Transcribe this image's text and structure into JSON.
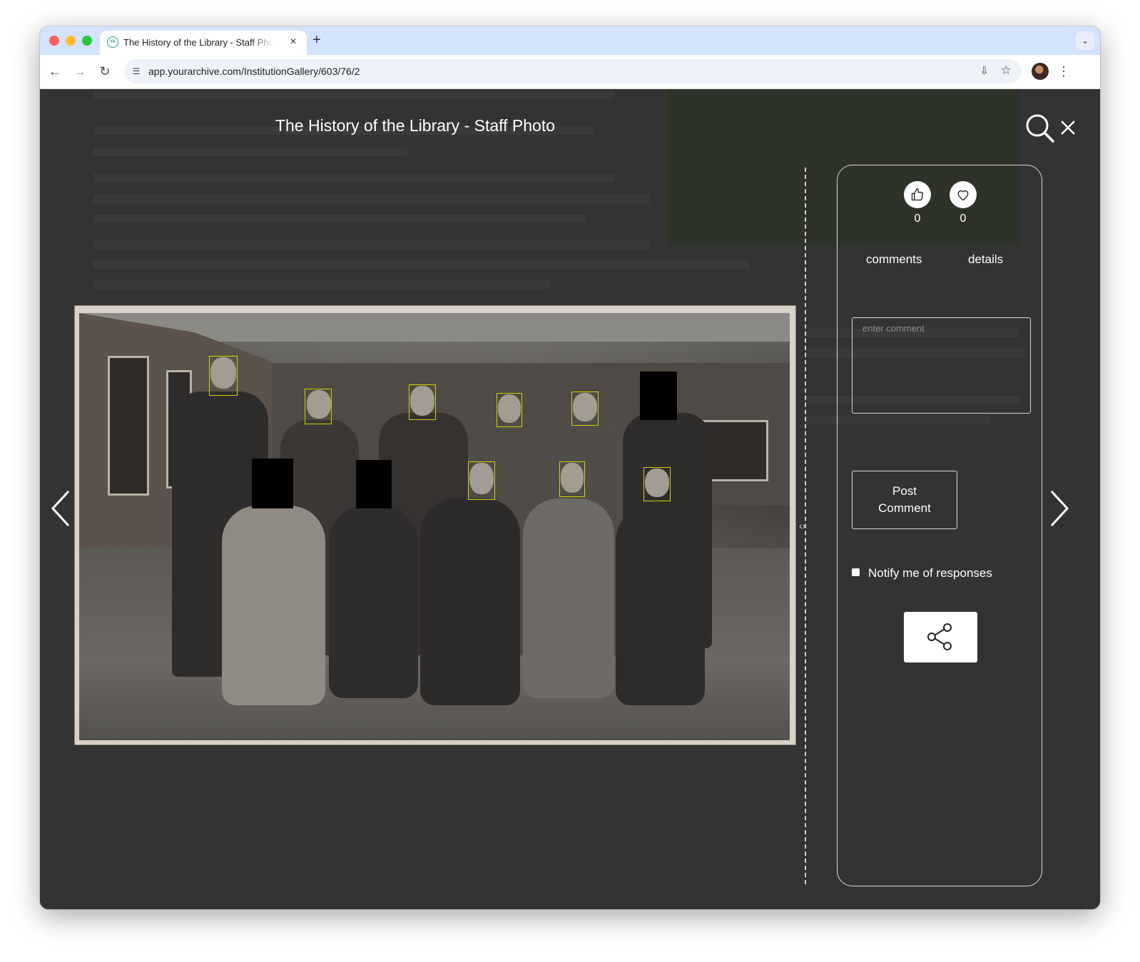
{
  "browser": {
    "tab_title": "The History of the Library - Staff Photo",
    "tab_close": "×",
    "new_tab": "+",
    "url": "app.yourarchive.com/InstitutionGallery/603/76/2"
  },
  "lightbox": {
    "title": "The History of the Library - Staff Photo",
    "photo_alt": "The History of the Library - Staff Photo"
  },
  "panel": {
    "like_count": "0",
    "favourite_count": "0",
    "tabs": [
      "comments",
      "details"
    ],
    "comment_placeholder": "enter comment",
    "post_button": "Post Comment",
    "notify_label": "Notify me of responses"
  },
  "icons": {
    "search": "search-icon",
    "close": "close-icon",
    "prev": "chevron-left-icon",
    "next": "chevron-right-icon",
    "like": "thumbs-up-icon",
    "favourite": "heart-icon",
    "share": "share-icon"
  },
  "colors": {
    "overlay_bg": "#333333",
    "face_box": "#d7d000",
    "tab_strip": "#d3e3fd"
  }
}
